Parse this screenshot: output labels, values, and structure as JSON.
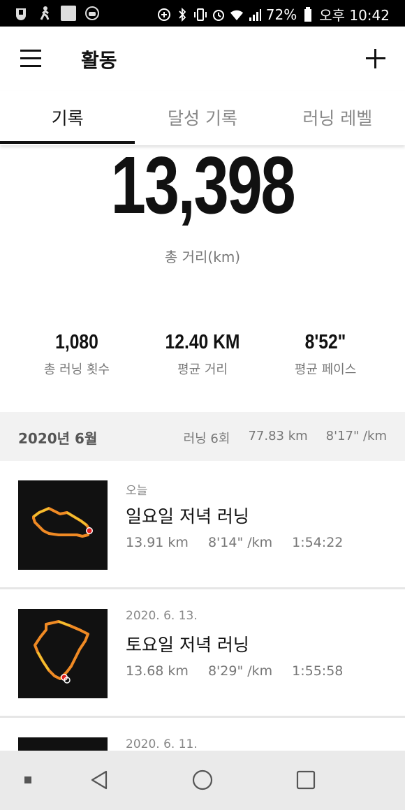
{
  "status_bar": {
    "battery": "72%",
    "time": "오후 10:42"
  },
  "app_bar": {
    "title": "활동"
  },
  "tabs": [
    {
      "label": "기록",
      "active": true
    },
    {
      "label": "달성 기록",
      "active": false
    },
    {
      "label": "러닝 레벨",
      "active": false
    }
  ],
  "summary": {
    "total_distance": "13,398",
    "total_distance_label": "총 거리(km)",
    "stats": [
      {
        "value": "1,080",
        "label": "총 러닝 횟수"
      },
      {
        "value": "12.40 KM",
        "label": "평균 거리"
      },
      {
        "value": "8'52\"",
        "label": "평균 페이스"
      }
    ]
  },
  "month": {
    "title": "2020년 6월",
    "runs": "러닝 6회",
    "distance": "77.83 km",
    "pace": "8'17\" /km"
  },
  "activities": [
    {
      "date": "오늘",
      "name": "일요일 저녁 러닝",
      "distance": "13.91 km",
      "pace": "8'14\" /km",
      "duration": "1:54:22"
    },
    {
      "date": "2020. 6. 13.",
      "name": "토요일 저녁 러닝",
      "distance": "13.68 km",
      "pace": "8'29\" /km",
      "duration": "1:55:58"
    },
    {
      "date": "2020. 6. 11."
    }
  ],
  "colors": {
    "route_orange": "#f08a24",
    "route_yellow": "#f2c12e",
    "route_end": "#e02020"
  }
}
